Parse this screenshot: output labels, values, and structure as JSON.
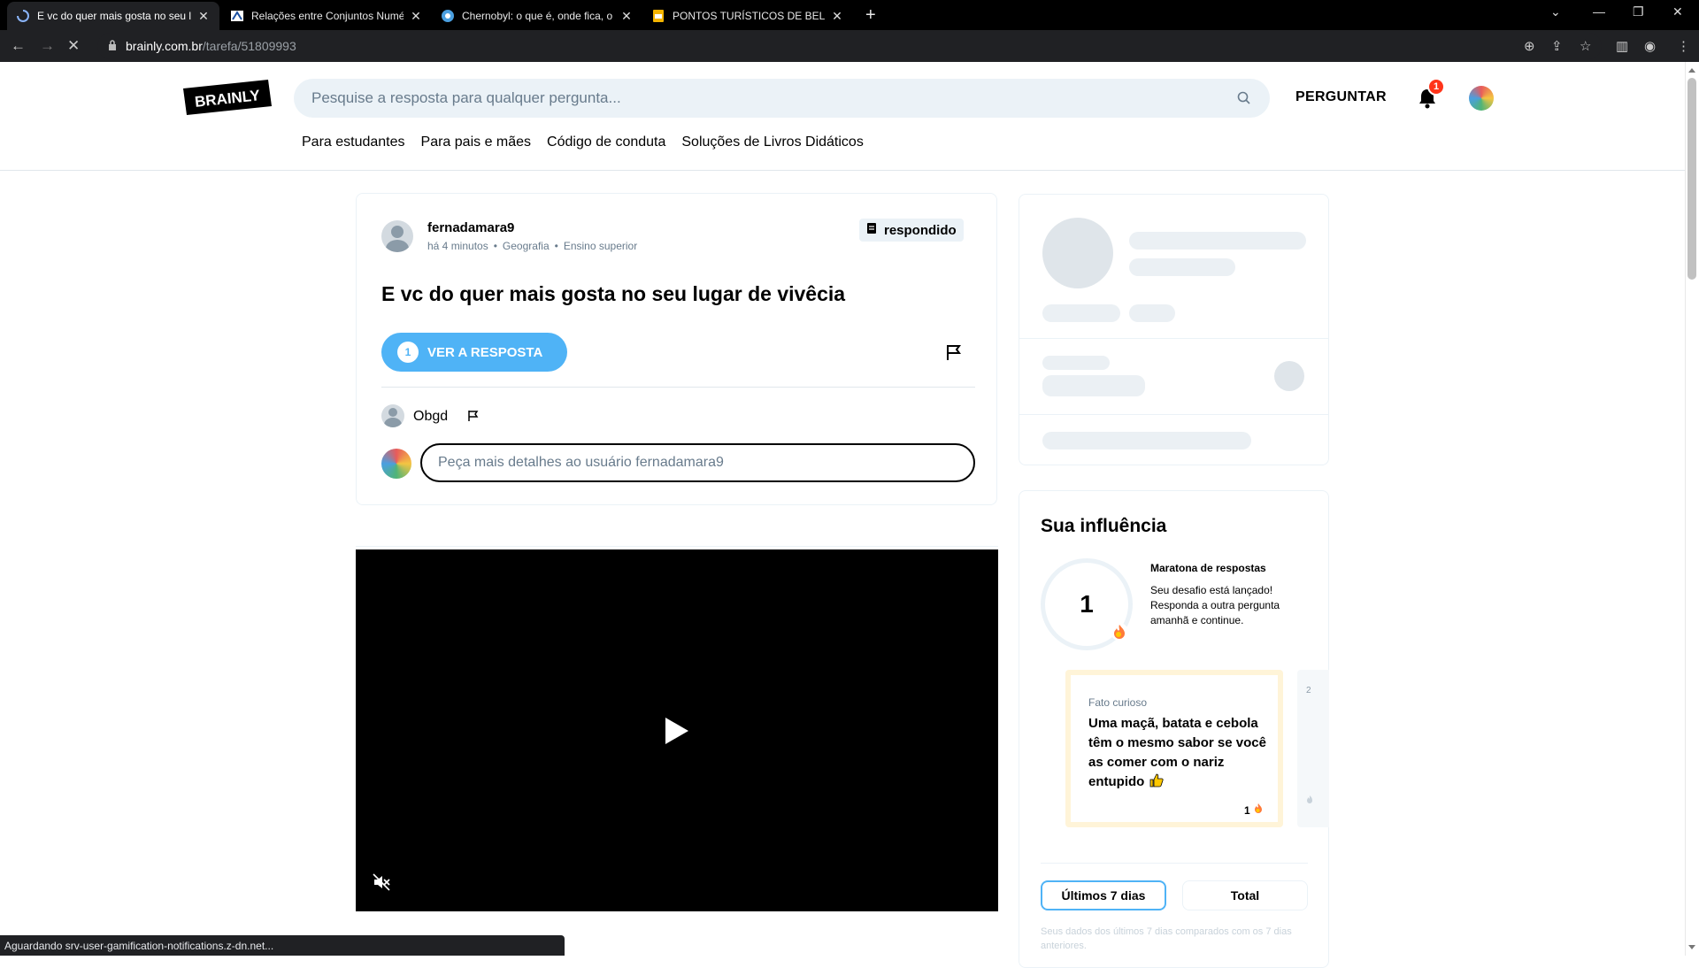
{
  "browser": {
    "tabs": [
      {
        "title": "E vc do quer mais gosta no seu l",
        "active": true
      },
      {
        "title": "Relações entre Conjuntos Numé",
        "active": false
      },
      {
        "title": "Chernobyl: o que é, onde fica, o",
        "active": false
      },
      {
        "title": "PONTOS TURÍSTICOS DE BELÉM:",
        "active": false
      }
    ],
    "url_host": "brainly.com.br",
    "url_path": "/tarefa/51809993",
    "status_text": "Aguardando srv-user-gamification-notifications.z-dn.net..."
  },
  "header": {
    "logo_text": "BRAINLY",
    "search_placeholder": "Pesquise a resposta para qualquer pergunta...",
    "ask_label": "PERGUNTAR",
    "notification_count": "1",
    "subnav": [
      "Para estudantes",
      "Para pais e mães",
      "Código de conduta",
      "Soluções de Livros Didáticos"
    ]
  },
  "question": {
    "author": "fernadamara9",
    "time": "há 4 minutos",
    "subject": "Geografia",
    "level": "Ensino superior",
    "status_label": "respondido",
    "title": "E vc do quer mais gosta no seu lugar de vivêcia",
    "answer_count": "1",
    "see_answer_label": "VER A RESPOSTA",
    "comment_text": "Obgd",
    "comment_placeholder": "Peça mais detalhes ao usuário fernadamara9"
  },
  "influence": {
    "title": "Sua influência",
    "streak_count": "1",
    "marathon_title": "Maratona de respostas",
    "marathon_desc": "Seu desafio está lançado! Responda a outra pergunta amanhã e continue.",
    "fact_label": "Fato curioso",
    "fact_text": "Uma maçã, batata e cebola têm o mesmo sabor se você as comer com o nariz entupido",
    "fact_count": "1",
    "next_card_number": "2",
    "tab_7_days": "Últimos 7 dias",
    "tab_total": "Total",
    "note": "Seus dados dos últimos 7 dias comparados com os 7 dias anteriores."
  },
  "colors": {
    "accent": "#4fb3f6",
    "brand_dark": "#000000",
    "badge_red": "#ff341a",
    "fact_border": "#fff4d8"
  }
}
